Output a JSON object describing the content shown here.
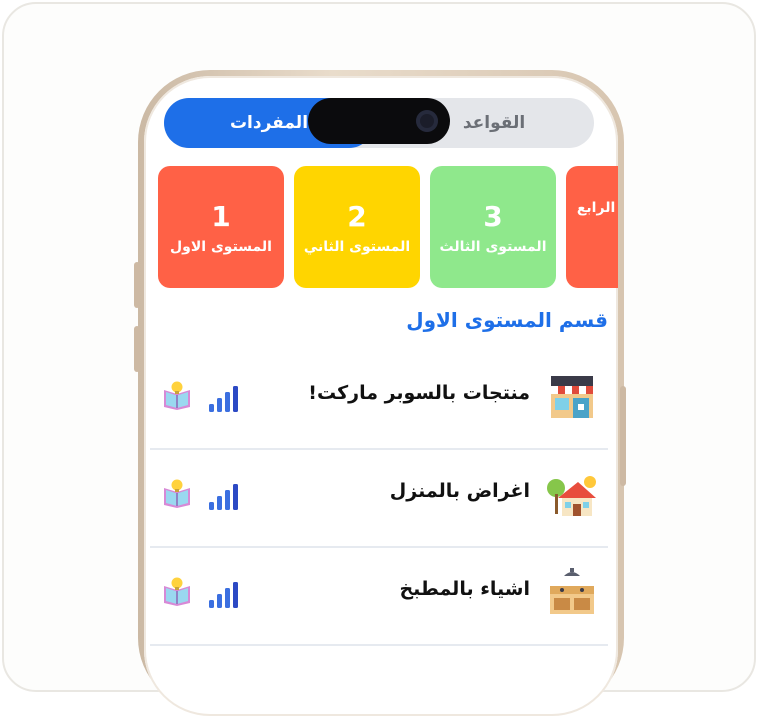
{
  "tabs": {
    "active_label": "المفردات",
    "inactive_label": "القواعد"
  },
  "levels": [
    {
      "number": "1",
      "name": "المستوى الاول",
      "color": "#ff6146"
    },
    {
      "number": "2",
      "name": "المستوى الثاني",
      "color": "#ffd500"
    },
    {
      "number": "3",
      "name": "المستوى الثالث",
      "color": "#8fe88c"
    },
    {
      "number": "",
      "name": "المستوى الرابع",
      "color": "#ff6146"
    }
  ],
  "section_title": "قسم المستوى الاول",
  "items": [
    {
      "label": "منتجات بالسوبر ماركت!",
      "icon": "supermarket-icon"
    },
    {
      "label": "اغراض بالمنزل",
      "icon": "house-icon"
    },
    {
      "label": "اشياء بالمطبخ",
      "icon": "kitchen-icon"
    }
  ],
  "colors": {
    "accent": "#1e6fe8",
    "signal_bars": "#2f5bd8",
    "book_icon": "#d789d6"
  }
}
